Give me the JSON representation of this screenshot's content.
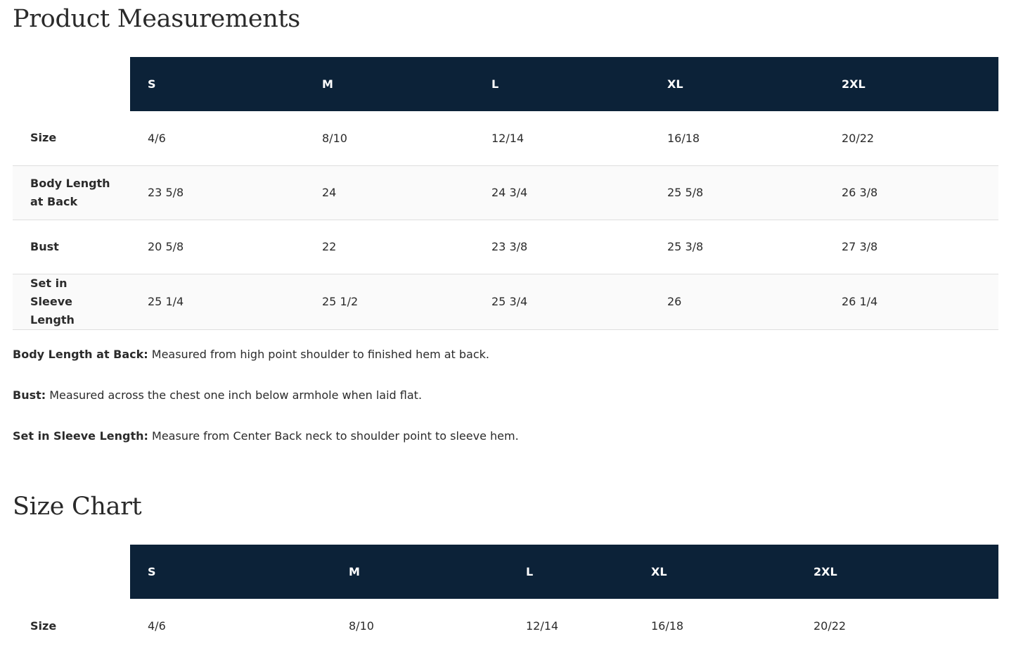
{
  "measurements": {
    "title": "Product Measurements",
    "columns": [
      "S",
      "M",
      "L",
      "XL",
      "2XL"
    ],
    "rows": [
      {
        "label": "Size",
        "values": [
          "4/6",
          "8/10",
          "12/14",
          "16/18",
          "20/22"
        ]
      },
      {
        "label": "Body Length at Back",
        "values": [
          "23 5/8",
          "24",
          "24 3/4",
          "25 5/8",
          "26 3/8"
        ]
      },
      {
        "label": "Bust",
        "values": [
          "20 5/8",
          "22",
          "23 3/8",
          "25 3/8",
          "27 3/8"
        ]
      },
      {
        "label": "Set in Sleeve Length",
        "values": [
          "25 1/4",
          "25 1/2",
          "25 3/4",
          "26",
          "26 1/4"
        ]
      }
    ]
  },
  "notes": [
    {
      "term": "Body Length at Back:",
      "text": "Measured from high point shoulder to finished hem at back."
    },
    {
      "term": "Bust:",
      "text": "Measured across the chest one inch below armhole when laid flat."
    },
    {
      "term": "Set in Sleeve Length:",
      "text": "Measure from Center Back neck to shoulder point to sleeve hem."
    }
  ],
  "size_chart": {
    "title": "Size Chart",
    "columns": [
      "S",
      "M",
      "L",
      "XL",
      "2XL"
    ],
    "rows": [
      {
        "label": "Size",
        "values": [
          "4/6",
          "8/10",
          "12/14",
          "16/18",
          "20/22"
        ]
      }
    ]
  },
  "colors": {
    "header_bg": "#0c2238",
    "header_text": "#ffffff",
    "row_divider": "#dedede",
    "alt_row_bg": "#fafafa"
  }
}
